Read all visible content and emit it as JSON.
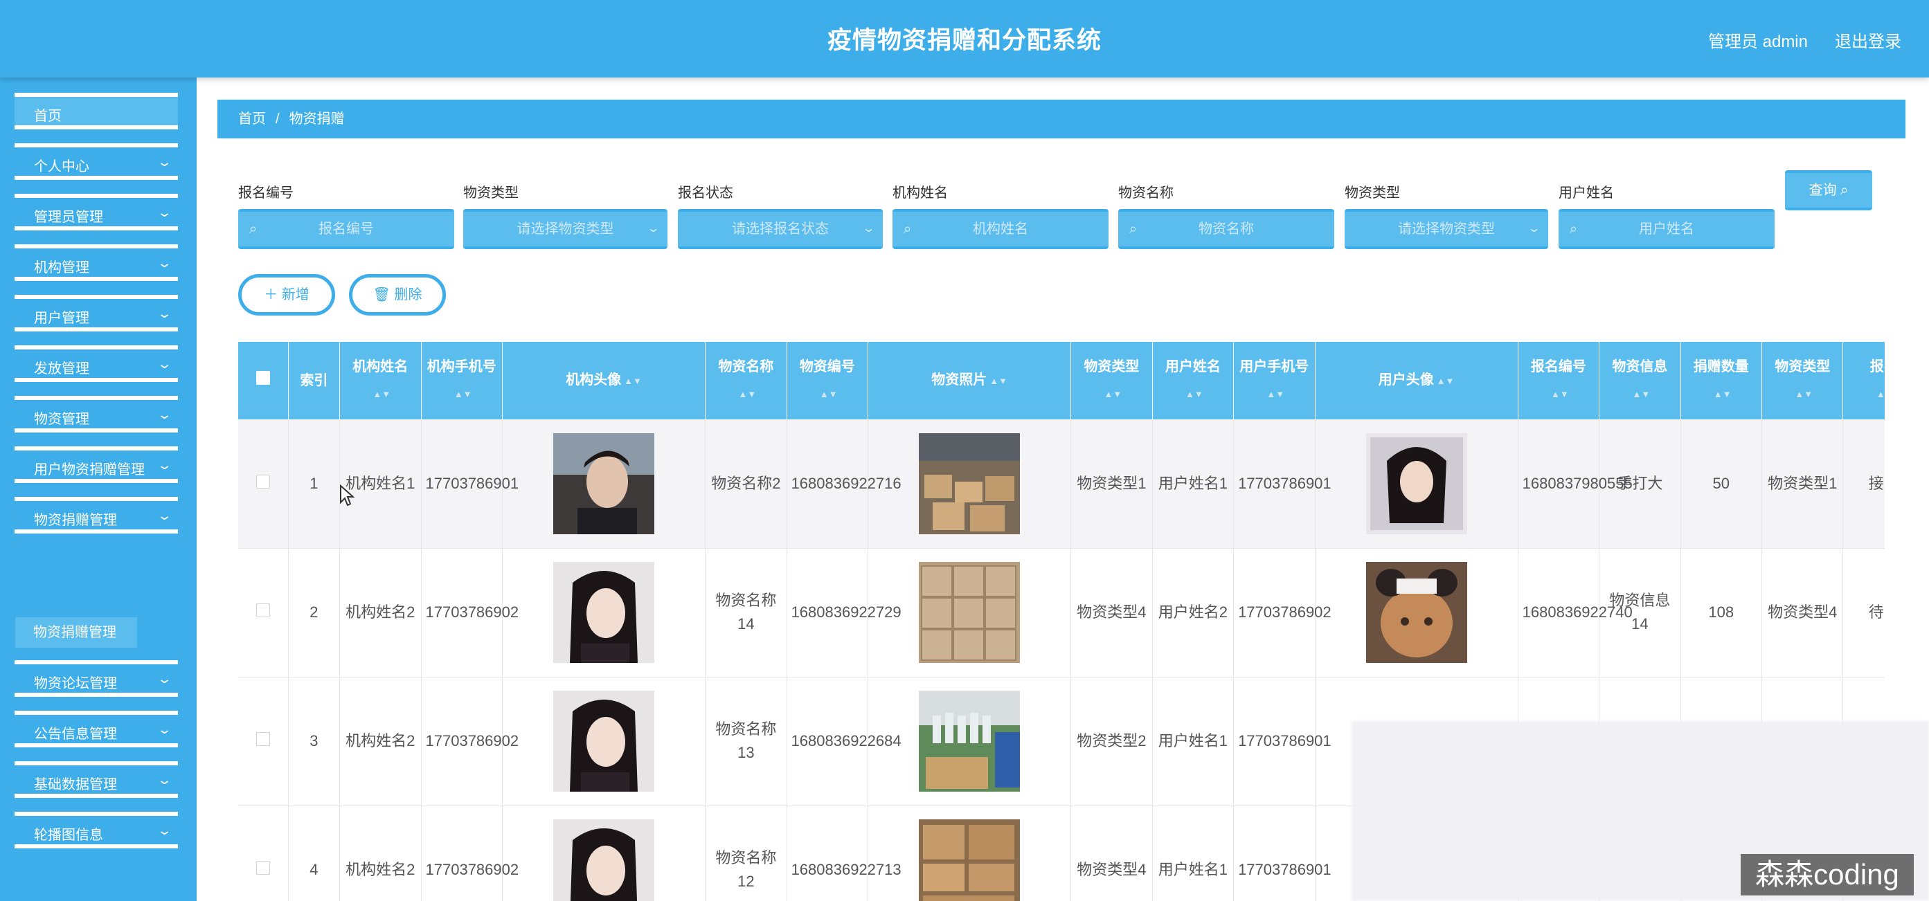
{
  "header": {
    "title": "疫情物资捐赠和分配系统",
    "admin": "管理员 admin",
    "logout": "退出登录"
  },
  "sidebar": {
    "items": [
      {
        "label": "首页",
        "chevron": false
      },
      {
        "label": "个人中心",
        "chevron": true
      },
      {
        "label": "管理员管理",
        "chevron": true
      },
      {
        "label": "机构管理",
        "chevron": true
      },
      {
        "label": "用户管理",
        "chevron": true
      },
      {
        "label": "发放管理",
        "chevron": true
      },
      {
        "label": "物资管理",
        "chevron": true
      },
      {
        "label": "用户物资捐赠管理",
        "chevron": true
      },
      {
        "label": "物资捐赠管理",
        "chevron": true
      },
      {
        "label": "物资论坛管理",
        "chevron": true
      },
      {
        "label": "公告信息管理",
        "chevron": true
      },
      {
        "label": "基础数据管理",
        "chevron": true
      },
      {
        "label": "轮播图信息",
        "chevron": true
      }
    ],
    "sub_item": "物资捐赠管理"
  },
  "breadcrumb": {
    "home": "首页",
    "sep": "/",
    "current": "物资捐赠"
  },
  "filters": [
    {
      "label": "报名编号",
      "placeholder": "报名编号",
      "type": "input"
    },
    {
      "label": "物资类型",
      "placeholder": "请选择物资类型",
      "type": "select"
    },
    {
      "label": "报名状态",
      "placeholder": "请选择报名状态",
      "type": "select"
    },
    {
      "label": "机构姓名",
      "placeholder": "机构姓名",
      "type": "input"
    },
    {
      "label": "物资名称",
      "placeholder": "物资名称",
      "type": "input"
    },
    {
      "label": "物资类型",
      "placeholder": "请选择物资类型",
      "type": "select"
    },
    {
      "label": "用户姓名",
      "placeholder": "用户姓名",
      "type": "input"
    }
  ],
  "buttons": {
    "query": "查询",
    "add": "新增",
    "delete": "删除"
  },
  "table": {
    "columns": [
      "索引",
      "机构姓名",
      "机构手机号",
      "机构头像",
      "物资名称",
      "物资编号",
      "物资照片",
      "物资类型",
      "用户姓名",
      "用户手机号",
      "用户头像",
      "报名编号",
      "物资信息",
      "捐赠数量",
      "物资类型",
      "报名"
    ],
    "rows": [
      {
        "idx": "1",
        "org": "机构姓名1",
        "phone": "17703786901",
        "goods": "物资名称2",
        "no": "1680836922716",
        "gtype": "物资类型1",
        "user": "用户姓名1",
        "uphone": "17703786901",
        "regno": "1680837980555",
        "info": "手打大",
        "qty": "50",
        "gtype2": "物资类型1",
        "status": "接受"
      },
      {
        "idx": "2",
        "org": "机构姓名2",
        "phone": "17703786902",
        "goods": "物资名称14",
        "no": "1680836922729",
        "gtype": "物资类型4",
        "user": "用户姓名2",
        "uphone": "17703786902",
        "regno": "1680836922740",
        "info": "物资信息14",
        "qty": "108",
        "gtype2": "物资类型4",
        "status": "待审"
      },
      {
        "idx": "3",
        "org": "机构姓名2",
        "phone": "17703786902",
        "goods": "物资名称13",
        "no": "1680836922684",
        "gtype": "物资类型2",
        "user": "用户姓名1",
        "uphone": "17703786901",
        "regno": "",
        "info": "",
        "qty": "",
        "gtype2": "",
        "status": ""
      },
      {
        "idx": "4",
        "org": "机构姓名2",
        "phone": "17703786902",
        "goods": "物资名称12",
        "no": "1680836922713",
        "gtype": "物资类型4",
        "user": "用户姓名1",
        "uphone": "17703786901",
        "regno": "",
        "info": "",
        "qty": "",
        "gtype2": "",
        "status": ""
      }
    ]
  },
  "watermark": "森森coding",
  "icons": [
    "search-icon",
    "chevron-down-icon",
    "plus-icon",
    "trash-icon",
    "sort-icon",
    "cursor-icon"
  ],
  "colors": {
    "primary": "#3daee9",
    "light": "#5bbcee"
  }
}
